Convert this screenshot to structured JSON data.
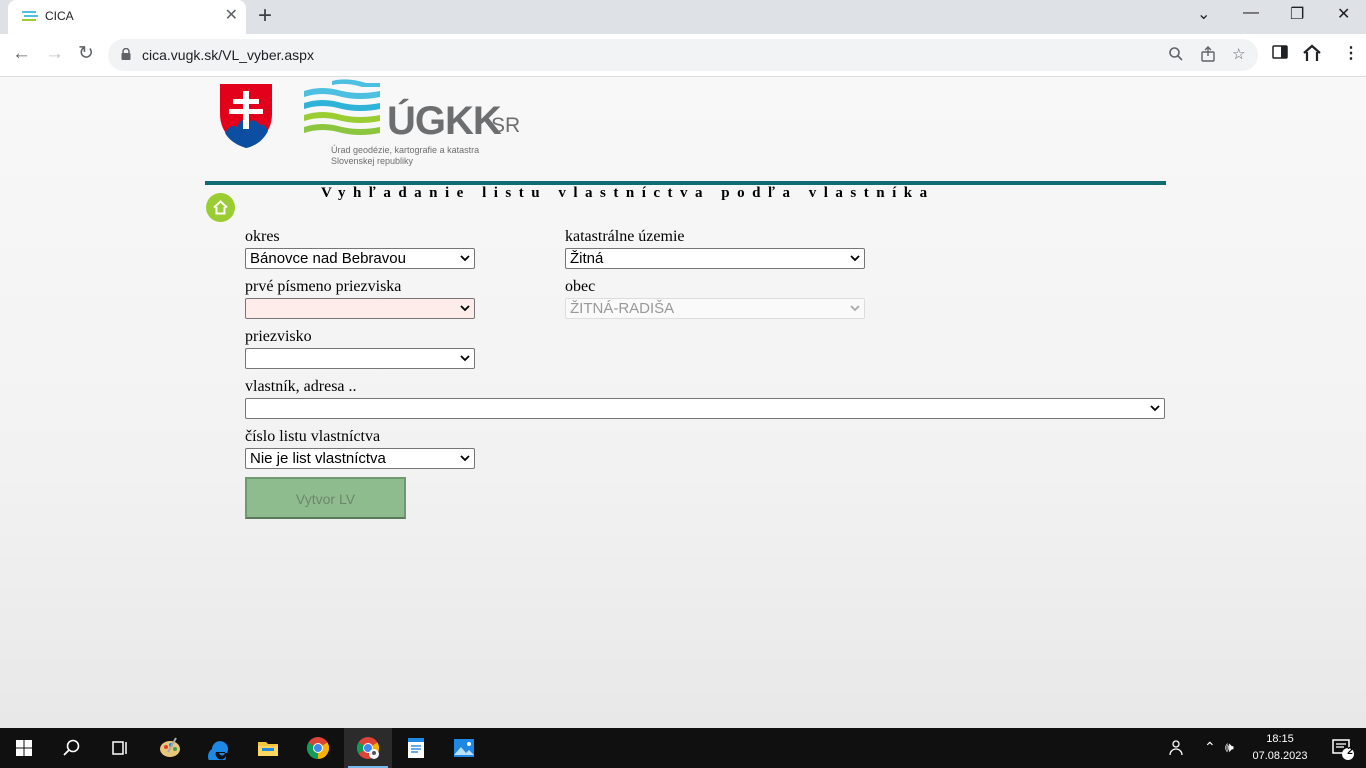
{
  "browser": {
    "tab_title": "CICA",
    "tab_close": "✕",
    "new_tab": "+",
    "url": "cica.vugk.sk/VL_vyber.aspx",
    "window_controls": {
      "minimize": "—",
      "restore": "❐",
      "close": "✕",
      "dropdown": "⌄"
    }
  },
  "header": {
    "logo_main": "ÚGKK",
    "logo_suffix": "SR",
    "logo_subtitle_1": "Úrad geodézie, kartografie a katastra",
    "logo_subtitle_2": "Slovenskej republiky",
    "page_heading": "Vyhľadanie listu vlastníctva podľa vlastníka"
  },
  "form": {
    "okres": {
      "label": "okres",
      "value": "Bánovce nad Bebravou"
    },
    "katastralne_uzemie": {
      "label": "katastrálne územie",
      "value": "Žitná"
    },
    "prve_pismeno": {
      "label": "prvé písmeno priezviska",
      "value": ""
    },
    "obec": {
      "label": "obec",
      "value": "ŽITNÁ-RADIŠA"
    },
    "priezvisko": {
      "label": "priezvisko",
      "value": ""
    },
    "vlastnik_adresa": {
      "label": "vlastník, adresa ..",
      "value": ""
    },
    "cislo_lv": {
      "label": "číslo listu vlastníctva",
      "value": "Nie je list vlastníctva"
    },
    "create_button": "Vytvor LV"
  },
  "taskbar": {
    "time": "18:15",
    "date": "07.08.2023",
    "notification_count": "2"
  },
  "colors": {
    "divider": "#116b73",
    "home_button": "#9acd32",
    "button_green": "#8fbc8f"
  }
}
